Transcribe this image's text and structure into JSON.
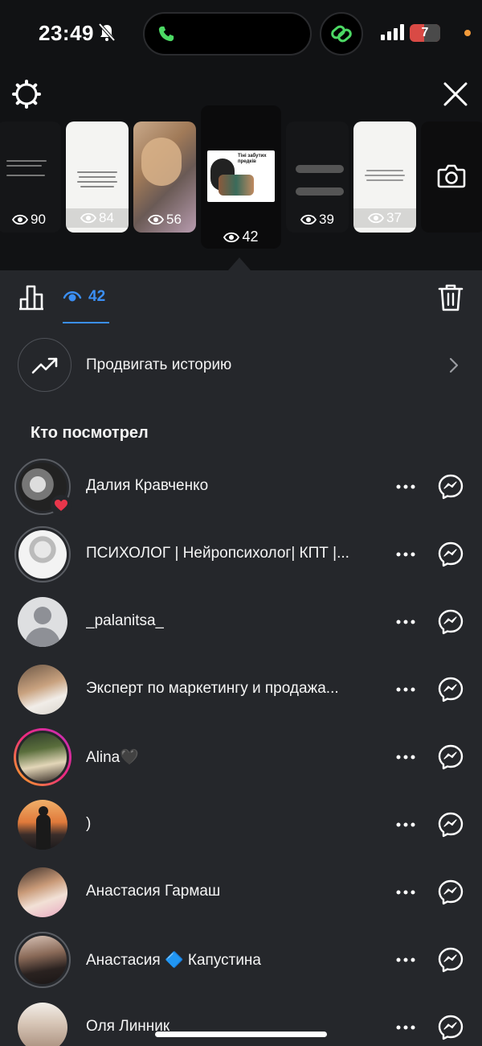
{
  "status_bar": {
    "time": "23:49",
    "battery": "7"
  },
  "stories": [
    {
      "views": "90",
      "style": "dark"
    },
    {
      "views": "84",
      "style": "white"
    },
    {
      "views": "56",
      "style": "photo"
    },
    {
      "views": "42",
      "style": "selected",
      "caption": "Тіні забутих предків"
    },
    {
      "views": "39",
      "style": "dark"
    },
    {
      "views": "37",
      "style": "white"
    }
  ],
  "tabs": {
    "viewers_count": "42"
  },
  "promote": {
    "label": "Продвигать историю"
  },
  "section_title": "Кто посмотрел",
  "viewers": [
    {
      "name": "Далия Кравченко",
      "avatar": "ring-grey",
      "liked": true
    },
    {
      "name": "ПСИХОЛОГ | Нейропсихолог| КПТ |...",
      "avatar": "ring-grey",
      "liked": false
    },
    {
      "name": "_palanitsa_",
      "avatar": "default",
      "liked": false
    },
    {
      "name": "Эксперт по маркетингу и продажа...",
      "avatar": "photo",
      "liked": false
    },
    {
      "name": "Alina🖤",
      "avatar": "ring-grad",
      "liked": false
    },
    {
      "name": ")",
      "avatar": "photo",
      "liked": false
    },
    {
      "name": "Анастасия Гармаш",
      "avatar": "photo",
      "liked": false
    },
    {
      "name": "Анастасия 🔷 Капустина",
      "avatar": "ring-grey",
      "liked": false
    },
    {
      "name": "Оля Линник",
      "avatar": "photo",
      "liked": false
    }
  ],
  "colors": {
    "accent": "#3b8ff5",
    "background": "#25272b",
    "top_background": "#111214",
    "like": "#e8364b"
  }
}
